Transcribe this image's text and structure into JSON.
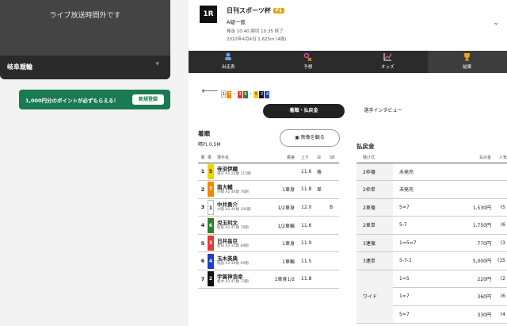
{
  "sidebar": {
    "live_notice": "ライブ放送時間外です",
    "venue": "岐阜競輪",
    "promo_text": "1,000円分のポイントが必ずもらえる！",
    "promo_button": "新規登録"
  },
  "race": {
    "number": "1R",
    "name": "日刊スポーツ杯",
    "grade": "F1",
    "class": "A級一般",
    "time": "発走 10:40 締切 10:35 終了",
    "date": "2022年4月4日 1,625m (4周)"
  },
  "tabs": [
    {
      "label": "出走表",
      "icon": "rider-icon"
    },
    {
      "label": "予想",
      "icon": "prediction-icon"
    },
    {
      "label": "オッズ",
      "icon": "odds-chart-icon"
    },
    {
      "label": "結果",
      "icon": "trophy-icon"
    }
  ],
  "lineup": [
    {
      "n": "1",
      "bg": "#ffffff",
      "fg": "#222222"
    },
    {
      "n": "7",
      "bg": "#f08a00",
      "fg": "#ffffff"
    },
    {
      "dot": "・"
    },
    {
      "n": "3",
      "bg": "#e53935",
      "fg": "#ffffff"
    },
    {
      "n": "6",
      "bg": "#2e7d32",
      "fg": "#ffffff"
    },
    {
      "dot": "・"
    },
    {
      "n": "5",
      "bg": "#f5d000",
      "fg": "#222222"
    },
    {
      "n": "2",
      "bg": "#111111",
      "fg": "#ffffff"
    },
    {
      "n": "4",
      "bg": "#1e40c8",
      "fg": "#ffffff"
    }
  ],
  "segments": {
    "active": "着順・払戻金",
    "other": "選手インタビュー"
  },
  "results": {
    "title": "着順",
    "weather": "晴れ 0.5M",
    "video_button": "映像を観る",
    "headers": [
      "着",
      "車",
      "選手名",
      "着差",
      "上り",
      "決",
      "SB"
    ],
    "rows": [
      {
        "rank": "1",
        "car": "5",
        "name": "寺沼伊織",
        "info": "東京 A1 24歳 115期",
        "diff": "",
        "up": "11.6",
        "dec": "捲",
        "sb": "",
        "bg": "#f5d000",
        "fg": "#222222"
      },
      {
        "rank": "2",
        "car": "7",
        "name": "南大輔",
        "info": "京都 A2 46歳 76期",
        "diff": "1車身",
        "up": "11.8",
        "dec": "差",
        "sb": "",
        "bg": "#f08a00",
        "fg": "#ffffff"
      },
      {
        "rank": "3",
        "car": "1",
        "name": "中井勇介",
        "info": "大阪 A2 40歳 100期",
        "diff": "1/2車身",
        "up": "12.0",
        "dec": "",
        "sb": "B",
        "bg": "#ffffff",
        "fg": "#222222"
      },
      {
        "rank": "4",
        "car": "6",
        "name": "児玉利文",
        "info": "岐阜 A2 47歳 76期",
        "diff": "1/2車輪",
        "up": "11.6",
        "dec": "",
        "sb": "",
        "bg": "#2e7d32",
        "fg": "#ffffff"
      },
      {
        "rank": "5",
        "car": "3",
        "name": "日井昌巨",
        "info": "愛知 A2 37歳 89期",
        "diff": "1車身",
        "up": "11.9",
        "dec": "",
        "sb": "",
        "bg": "#e53935",
        "fg": "#ffffff"
      },
      {
        "rank": "6",
        "car": "4",
        "name": "玉木英典",
        "info": "福島 A2 36歳 95期",
        "diff": "1車輪",
        "up": "11.5",
        "dec": "",
        "sb": "",
        "bg": "#1e40c8",
        "fg": "#ffffff"
      },
      {
        "rank": "7",
        "car": "2",
        "name": "宇賀神浩幸",
        "info": "栃木 A2 47歳 73期",
        "diff": "1車身1/2",
        "up": "11.8",
        "dec": "",
        "sb": "",
        "bg": "#111111",
        "fg": "#ffffff"
      }
    ]
  },
  "payouts": {
    "title": "払戻金",
    "headers": [
      "賭け式",
      "",
      "払戻金",
      "人気"
    ],
    "rows": [
      {
        "type": "2枠複",
        "combo": "未発売",
        "amount": "",
        "pop": ""
      },
      {
        "type": "2枠単",
        "combo": "未発売",
        "amount": "",
        "pop": ""
      },
      {
        "type": "2車複",
        "combo": "5=7",
        "amount": "1,530円",
        "pop": "(5"
      },
      {
        "type": "2車単",
        "combo": "5-7",
        "amount": "1,750円",
        "pop": "(6"
      },
      {
        "type": "3連複",
        "combo": "1=5=7",
        "amount": "770円",
        "pop": "(3"
      },
      {
        "type": "3連単",
        "combo": "5-7-1",
        "amount": "5,000円",
        "pop": "(15"
      },
      {
        "type": "ワイド",
        "combo": "1=5",
        "amount": "220円",
        "pop": "(2"
      },
      {
        "type": "",
        "combo": "1=7",
        "amount": "360円",
        "pop": "(6"
      },
      {
        "type": "",
        "combo": "5=7",
        "amount": "330円",
        "pop": "(4"
      }
    ]
  }
}
